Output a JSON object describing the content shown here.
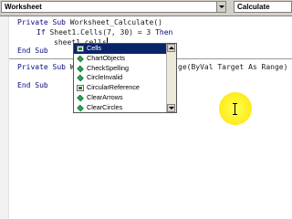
{
  "toolbar": {
    "object_value": "Worksheet",
    "procedure_value": "Calculate"
  },
  "code": {
    "line1_kw": "Private Sub",
    "line1_rest": " Worksheet_Calculate()",
    "line2_kw": "If",
    "line2_mid": " Sheet1.Cells(7, 30) = 3 ",
    "line2_kw2": "Then",
    "line3": "sheet1.cells",
    "line4": "End Sub",
    "line5_kw": "Private Sub",
    "line5_rest": " W",
    "line5_tail": "ge(ByVal Target As Range)",
    "line6": "End Sub"
  },
  "autocomplete": {
    "items": [
      {
        "label": "Cells",
        "icon": "property-icon",
        "selected": true
      },
      {
        "label": "ChartObjects",
        "icon": "method-icon",
        "selected": false
      },
      {
        "label": "CheckSpelling",
        "icon": "method-icon",
        "selected": false
      },
      {
        "label": "CircleInvalid",
        "icon": "method-icon",
        "selected": false
      },
      {
        "label": "CircularReference",
        "icon": "property-icon",
        "selected": false
      },
      {
        "label": "ClearArrows",
        "icon": "method-icon",
        "selected": false
      },
      {
        "label": "ClearCircles",
        "icon": "method-icon",
        "selected": false
      }
    ]
  },
  "colors": {
    "selection": "#0a246a",
    "cursor_highlight": "#ffee22",
    "keyword": "#0a0a7a"
  }
}
